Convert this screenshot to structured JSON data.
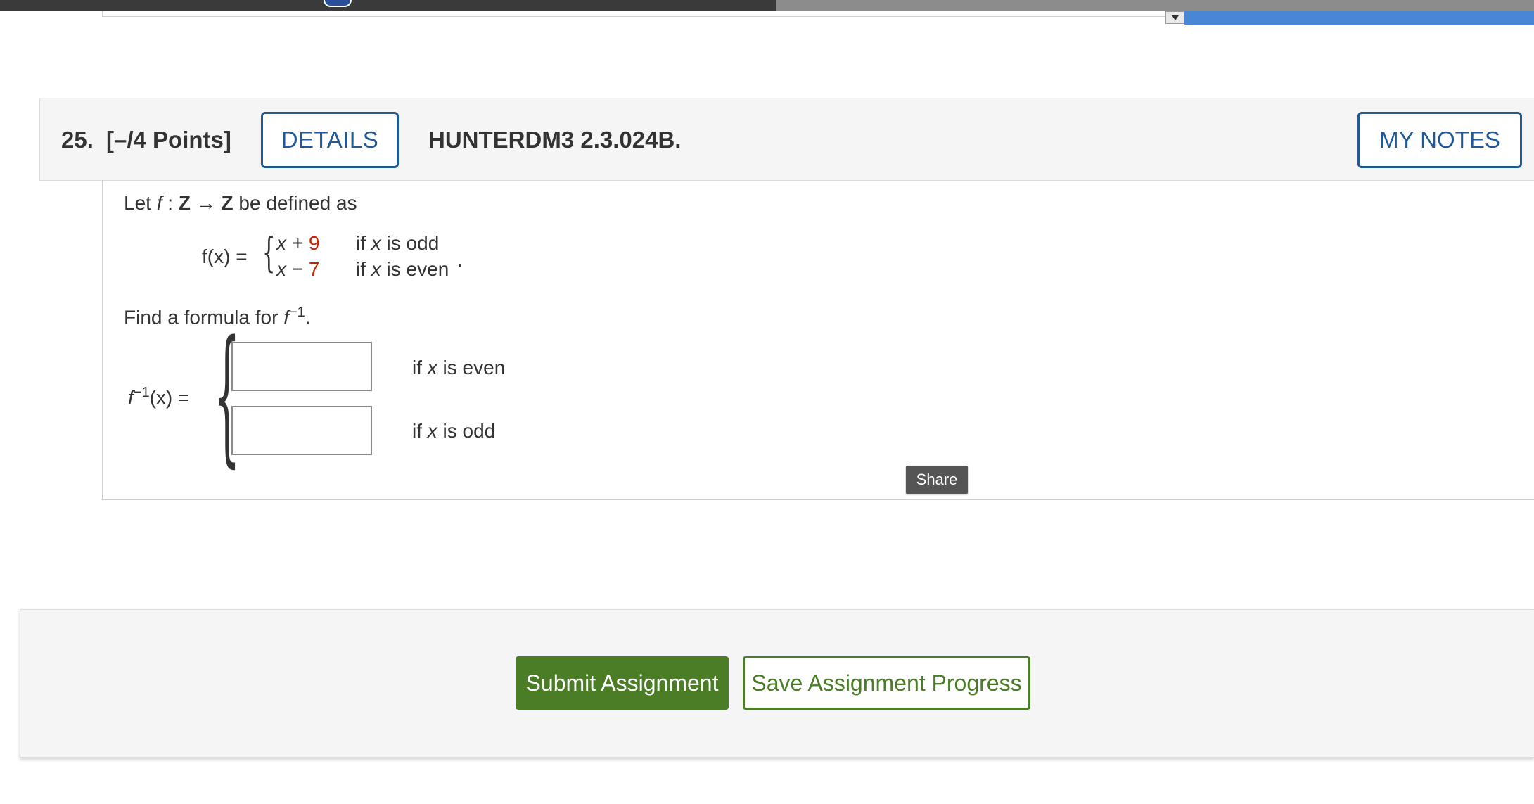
{
  "question": {
    "number": "25.",
    "points": "[–/4 Points]",
    "details_label": "DETAILS",
    "code": "HUNTERDM3 2.3.024B.",
    "notes_label": "MY NOTES"
  },
  "problem": {
    "intro_let": "Let",
    "intro_f": "f",
    "intro_colon": " : ",
    "intro_Z1": "Z",
    "intro_arrow": " → ",
    "intro_Z2": "Z",
    "intro_rest": " be defined as",
    "fx_label": "f(x) =",
    "case1_x": "x + ",
    "case1_const": "9",
    "case1_cond_if": "if ",
    "case1_cond_x": "x",
    "case1_cond_rest": " is odd",
    "case2_x": "x − ",
    "case2_const": "7",
    "case2_cond_if": "if ",
    "case2_cond_x": "x",
    "case2_cond_rest": " is even",
    "period": ".",
    "find_text": "Find a formula for ",
    "find_f": "f",
    "find_sup": "−1",
    "find_end": ".",
    "finv_f": "f",
    "finv_sup": "−1",
    "finv_rest": "(x) =",
    "answer1_value": "",
    "answer2_value": "",
    "answer1_cond_if": "if ",
    "answer1_cond_x": "x",
    "answer1_cond_rest": " is even",
    "answer2_cond_if": "if ",
    "answer2_cond_x": "x",
    "answer2_cond_rest": " is odd"
  },
  "share_label": "Share",
  "footer": {
    "submit_label": "Submit Assignment",
    "save_label": "Save Assignment Progress"
  },
  "colors": {
    "accent_blue": "#1f5a96",
    "submit_green": "#4a7d26",
    "highlight_red": "#cc2200"
  }
}
